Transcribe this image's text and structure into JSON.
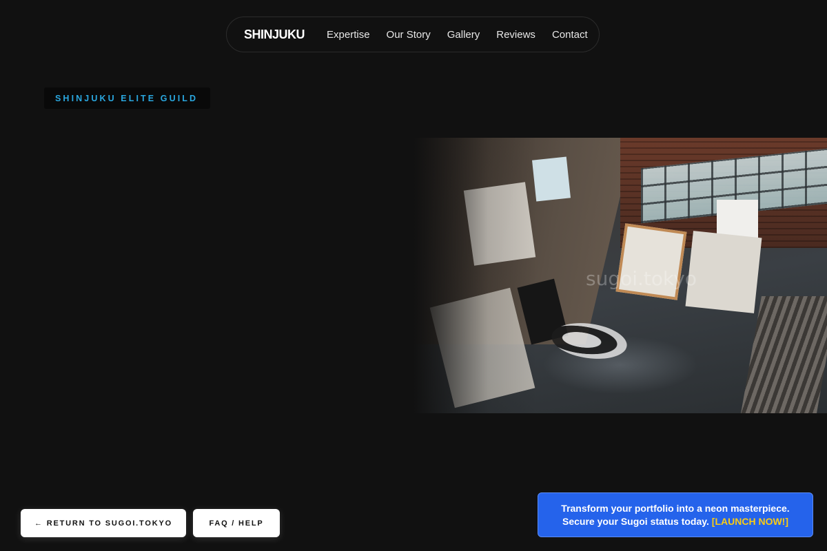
{
  "nav": {
    "brand": "SHINJUKU",
    "links": [
      "Expertise",
      "Our Story",
      "Gallery",
      "Reviews",
      "Contact"
    ]
  },
  "hero": {
    "badge": "SHINJUKU ELITE GUILD",
    "image_watermark": "sugoi.tokyo"
  },
  "footer_buttons": {
    "return_label": "← RETURN TO SUGOI.TOKYO",
    "faq_label": "FAQ / HELP"
  },
  "cta": {
    "line1": "Transform your portfolio into a neon masterpiece.",
    "line2": "Secure your Sugoi status today.",
    "link": "[LAUNCH NOW!]"
  },
  "colors": {
    "background": "#111111",
    "badge_text": "#2aa7df",
    "cta_bg": "#2563eb",
    "cta_accent": "#facc15"
  }
}
